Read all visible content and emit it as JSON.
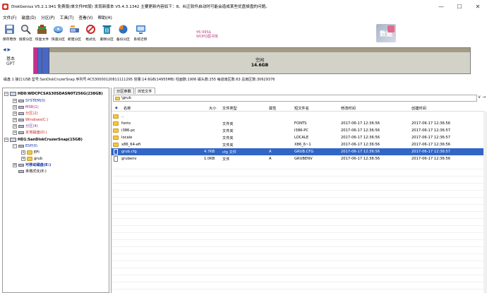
{
  "window": {
    "title": "DiskGenius V5.2.1.941 免费版(单文件PE版)",
    "update_notice": "发现新版本 V5.4.3.1342 主要更新内容如下：8、纠正软件启动时可能会造成某些优盘掉盘的问题。",
    "controls": {
      "minimize": "—",
      "maximize": "☐",
      "close": "✕"
    }
  },
  "menu": [
    {
      "label": "文件(F)"
    },
    {
      "label": "磁盘(D)"
    },
    {
      "label": "分区(P)"
    },
    {
      "label": "工具(T)"
    },
    {
      "label": "查看(V)"
    },
    {
      "label": "帮助(H)"
    }
  ],
  "toolbar": [
    {
      "label": "保存更改",
      "icon": "save-icon",
      "color": "#5a7fb2"
    },
    {
      "label": "搜索分区",
      "icon": "search-icon",
      "color": "#6c6c6c"
    },
    {
      "label": "恢复文件",
      "icon": "recover-icon",
      "color": "#3f8f3a"
    },
    {
      "label": "快速分区",
      "icon": "quick-partition-icon",
      "color": "#2f6fc4"
    },
    {
      "label": "新建分区",
      "icon": "new-partition-icon",
      "color": "#4c6fb0"
    },
    {
      "label": "格式化",
      "icon": "format-icon",
      "color": "#c92c2c"
    },
    {
      "label": "删除分区",
      "icon": "delete-partition-icon",
      "color": "#2a8fb8"
    },
    {
      "label": "备份分区",
      "icon": "backup-partition-icon",
      "color": "#e0862a"
    },
    {
      "label": "系统迁移",
      "icon": "system-migrate-icon",
      "color": "#3a7ac8"
    }
  ],
  "promo": {
    "line1": "¥6-99S$",
    "line2": "WOPQ图书馆"
  },
  "logo_text": "数据",
  "disk_map": {
    "nav": "◀ ▶",
    "type_line1": "基本",
    "type_line2": "GPT",
    "free_label": "空闲",
    "free_size": "14.6GB"
  },
  "disk_info": "磁盘 1 接口:USB  型号:SanDiskCruzerSnap  序列号:4C530000120811111295  容量:14.6GB(14955MB)  柱面数:1906  磁头数:255  每道扇区数:63  总扇区数:30629376",
  "tree": [
    {
      "label": "HD0:WDCPCSAS30SDASN0T256G(238GB)",
      "level": 0,
      "expander": "−",
      "icon": "disk-icon"
    },
    {
      "label": "SYSTEM(0)",
      "level": 1,
      "expander": "+",
      "icon": "partition-icon",
      "color": "#1432a6"
    },
    {
      "label": "MSR(1)",
      "level": 1,
      "expander": "+",
      "icon": "partition-icon",
      "color": "#b3129b"
    },
    {
      "label": "分区(2)",
      "level": 1,
      "expander": "+",
      "icon": "partition-icon",
      "color": "#c8271d"
    },
    {
      "label": "Windows(C:)",
      "level": 1,
      "expander": "+",
      "icon": "partition-icon",
      "color": "#c8271d"
    },
    {
      "label": "分区(4)",
      "level": 1,
      "expander": "+",
      "icon": "partition-icon",
      "color": "#7b2fa8"
    },
    {
      "label": "本地磁盘(D:)",
      "level": 1,
      "expander": "+",
      "icon": "partition-icon",
      "color": "#c8271d"
    },
    {
      "label": "HD1:SanDiskCruzerSnap(15GB)",
      "level": 0,
      "expander": "−",
      "icon": "disk-icon"
    },
    {
      "label": "ESP(0)",
      "level": 1,
      "expander": "−",
      "icon": "partition-icon",
      "color": "#1432a6"
    },
    {
      "label": "EFI",
      "level": 2,
      "expander": "+",
      "icon": "folder-icon"
    },
    {
      "label": "grub",
      "level": 2,
      "expander": "+",
      "icon": "folder-icon"
    },
    {
      "label": "可移动磁盘(E:)",
      "level": 1,
      "expander": "+",
      "icon": "partition-icon",
      "color": "#1432a6"
    },
    {
      "label": "未格式化(E:)",
      "level": 1,
      "expander": "",
      "icon": "partition-icon"
    }
  ],
  "tabs": [
    {
      "label": "分区参数"
    },
    {
      "label": "浏览文件"
    }
  ],
  "path": "\\grub",
  "path_buttons": "∨ →",
  "columns": {
    "name": "名称",
    "size": "大小",
    "type": "文件类型",
    "attr": "属性",
    "short": "短文件名",
    "modified": "修改时间",
    "created": "创建时间"
  },
  "files": [
    {
      "name": "..",
      "size": "",
      "type": "",
      "attr": "",
      "short": "",
      "modified": "",
      "created": "",
      "kind": "folder"
    },
    {
      "name": "fonts",
      "size": "",
      "type": "文件夹",
      "attr": "",
      "short": "FONTS",
      "modified": "2017-06-17 12:36:56",
      "created": "2017-06-17 12:36:56",
      "kind": "folder"
    },
    {
      "name": "i386-pc",
      "size": "",
      "type": "文件夹",
      "attr": "",
      "short": "I386-PC",
      "modified": "2017-06-17 12:36:56",
      "created": "2017-06-17 12:36:57",
      "kind": "folder"
    },
    {
      "name": "locale",
      "size": "",
      "type": "文件夹",
      "attr": "",
      "short": "LOCALE",
      "modified": "2017-06-17 12:36:56",
      "created": "2017-06-17 12:36:57",
      "kind": "folder"
    },
    {
      "name": "x86_64-efi",
      "size": "",
      "type": "文件夹",
      "attr": "",
      "short": "X86_6~1",
      "modified": "2017-06-17 12:36:56",
      "created": "2017-06-17 12:36:56",
      "kind": "folder"
    },
    {
      "name": "grub.cfg",
      "size": "4.7KB",
      "type": "cfg 文件",
      "attr": "A",
      "short": "GRUB.CFG",
      "modified": "2017-06-17 12:36:56",
      "created": "2017-06-17 12:36:57",
      "kind": "file",
      "selected": true
    },
    {
      "name": "grubenv",
      "size": "1.0KB",
      "type": "文件",
      "attr": "A",
      "short": "GRUBENV",
      "modified": "2017-06-17 12:36:56",
      "created": "2017-06-17 12:36:56",
      "kind": "file"
    }
  ]
}
